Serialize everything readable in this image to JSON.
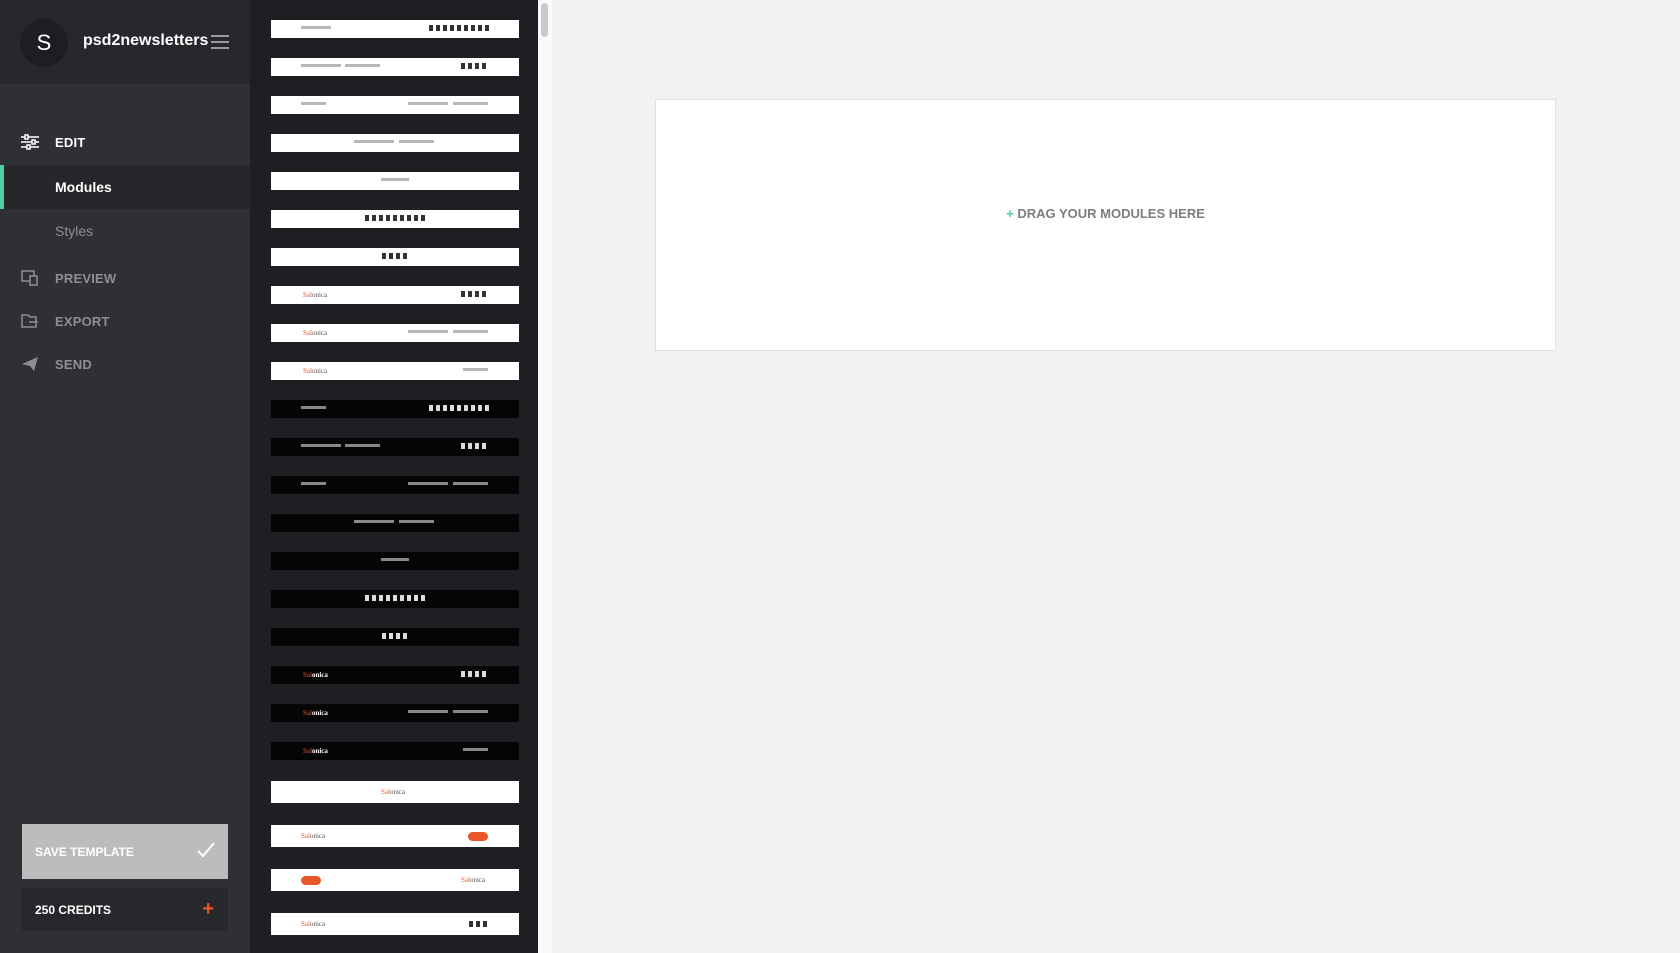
{
  "app": {
    "avatar_letter": "S",
    "brand": "psd2newsletters"
  },
  "nav": {
    "edit": "EDIT",
    "modules": "Modules",
    "styles": "Styles",
    "preview": "PREVIEW",
    "export": "EXPORT",
    "send": "SEND"
  },
  "actions": {
    "save_template": "SAVE TEMPLATE",
    "credits": "250 CREDITS"
  },
  "canvas": {
    "drop_plus": "+",
    "drop_text": "DRAG YOUR MODULES HERE"
  },
  "colors": {
    "accent": "#4fcfa0",
    "brand_orange": "#e8562a",
    "sidebar_bg": "#2f3035",
    "panel_bg": "#1e1f22"
  },
  "module_logo": {
    "prefix": "Sal",
    "suffix": "onica"
  }
}
